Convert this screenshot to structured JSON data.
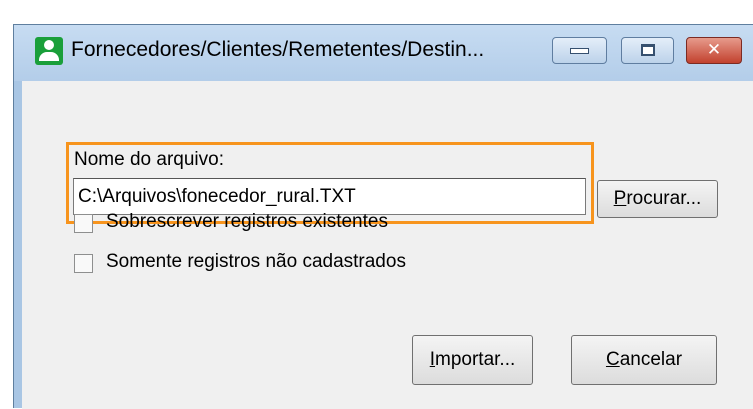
{
  "window": {
    "title": "Fornecedores/Clientes/Remetentes/Destin...",
    "icon": "user-icon",
    "controls": {
      "minimize": "minimize-icon",
      "maximize": "maximize-icon",
      "close_glyph": "✕"
    }
  },
  "file": {
    "label": "Nome do arquivo:",
    "value": "C:\\Arquivos\\fonecedor_rural.TXT"
  },
  "buttons": {
    "browse_mnemonic": "P",
    "browse_rest": "rocurar...",
    "import_mnemonic": "I",
    "import_rest": "mportar...",
    "cancel_mnemonic": "C",
    "cancel_rest": "ancelar"
  },
  "options": [
    {
      "label": "Sobrescrever registros existentes",
      "checked": false
    },
    {
      "label": "Somente registros não cadastrados",
      "checked": false
    }
  ],
  "colors": {
    "highlight": "#f7941d",
    "titlebar": "#b9d1ea",
    "close": "#c2412e"
  }
}
